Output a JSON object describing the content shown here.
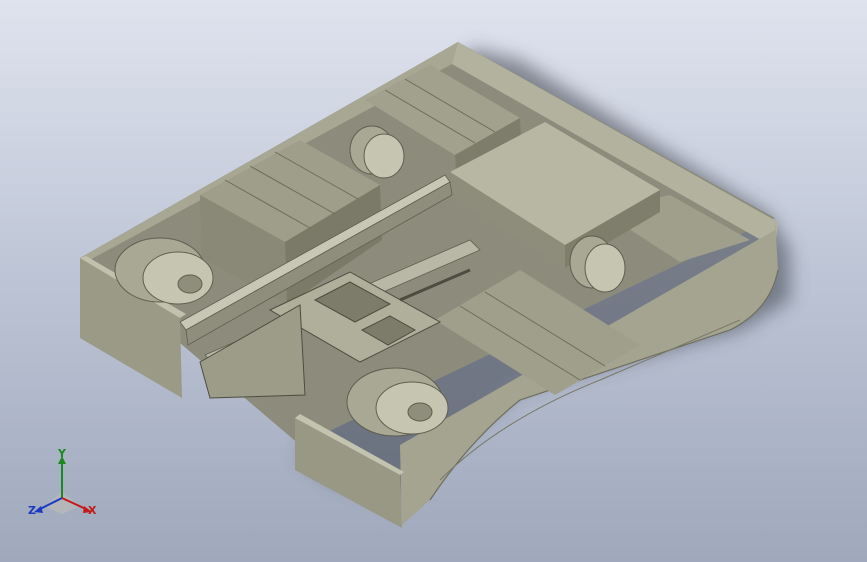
{
  "viewport": {
    "background_top": "#dfe3ee",
    "background_bottom": "#9fa8bc",
    "model_color": "#a3a28e"
  },
  "triad": {
    "y_label": "Y",
    "x_label": "X",
    "z_label": "Z",
    "colors": {
      "x": "#c41a1a",
      "y": "#1a8a1a",
      "z": "#1a3ac4"
    }
  }
}
